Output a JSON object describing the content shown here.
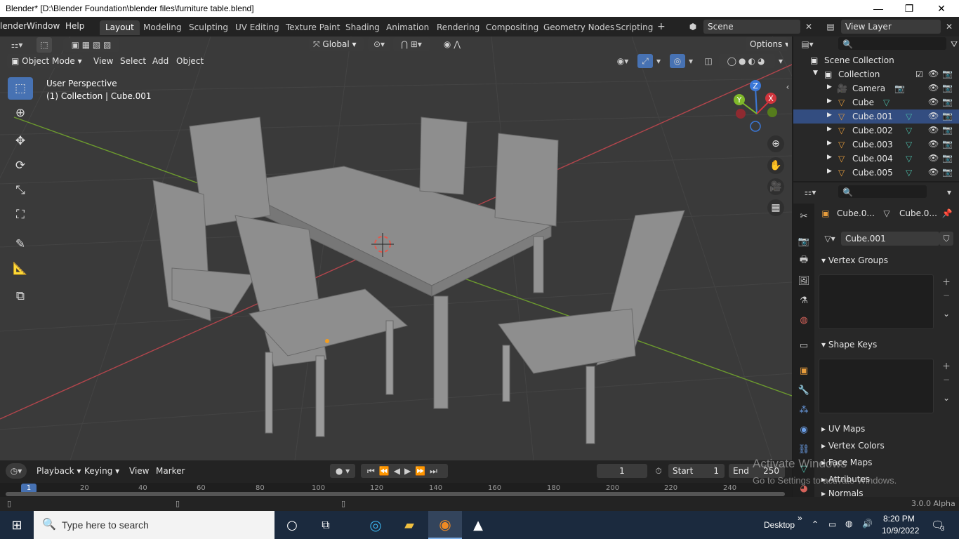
{
  "window": {
    "title": "Blender* [D:\\Blender Foundation\\blender files\\furniture table.blend]",
    "minimize": "—",
    "maximize": "❐",
    "close": "✕"
  },
  "menubar": {
    "items": [
      "lender",
      "Window",
      "Help"
    ]
  },
  "workspace_tabs": [
    {
      "label": "Layout",
      "active": true
    },
    {
      "label": "Modeling"
    },
    {
      "label": "Sculpting"
    },
    {
      "label": "UV Editing"
    },
    {
      "label": "Texture Paint"
    },
    {
      "label": "Shading"
    },
    {
      "label": "Animation"
    },
    {
      "label": "Rendering"
    },
    {
      "label": "Compositing"
    },
    {
      "label": "Geometry Nodes"
    },
    {
      "label": "Scripting"
    }
  ],
  "add_workspace": "+",
  "scene": {
    "value": "Scene"
  },
  "view_layer": {
    "value": "View Layer"
  },
  "viewport": {
    "mode": "Object Mode",
    "menus": [
      "View",
      "Select",
      "Add",
      "Object"
    ],
    "transform_orientation": "Global",
    "options": "Options",
    "perspective_label": "User Perspective",
    "collection_label": "(1) Collection | Cube.001"
  },
  "outliner": {
    "scene_collection": "Scene Collection",
    "collection": "Collection",
    "objects": [
      {
        "name": "Camera",
        "icon": "camera-icon"
      },
      {
        "name": "Cube",
        "icon": "mesh-icon"
      },
      {
        "name": "Cube.001",
        "icon": "mesh-icon",
        "selected": true
      },
      {
        "name": "Cube.002",
        "icon": "mesh-icon"
      },
      {
        "name": "Cube.003",
        "icon": "mesh-icon"
      },
      {
        "name": "Cube.004",
        "icon": "mesh-icon"
      },
      {
        "name": "Cube.005",
        "icon": "mesh-icon"
      }
    ]
  },
  "properties": {
    "breadcrumb_object": "Cube.0...",
    "breadcrumb_mesh": "Cube.0...",
    "mesh_name": "Cube.001",
    "panels": {
      "vertex_groups": "Vertex Groups",
      "shape_keys": "Shape Keys",
      "uv_maps": "UV Maps",
      "vertex_colors": "Vertex Colors",
      "face_maps": "Face Maps",
      "attributes": "Attributes",
      "normals": "Normals"
    }
  },
  "timeline": {
    "menus": [
      "Playback",
      "Keying",
      "View",
      "Marker"
    ],
    "current_frame": "1",
    "start_label": "Start",
    "start_value": "1",
    "end_label": "End",
    "end_value": "250",
    "ruler": [
      "1",
      "20",
      "40",
      "60",
      "80",
      "100",
      "120",
      "140",
      "160",
      "180",
      "200",
      "220",
      "240"
    ]
  },
  "statusbar": {
    "version": "3.0.0 Alpha"
  },
  "watermark": {
    "line1": "Activate Windows",
    "line2": "Go to Settings to activate Windows."
  },
  "taskbar": {
    "search_placeholder": "Type here to search",
    "desktop": "Desktop",
    "time": "8:20 PM",
    "date": "10/9/2022",
    "notifications": "3"
  },
  "colors": {
    "accent": "#4772b3",
    "selection": "#334d80",
    "x_axis": "#d0343c",
    "y_axis": "#7fb82a",
    "z_axis": "#3b78d8"
  }
}
